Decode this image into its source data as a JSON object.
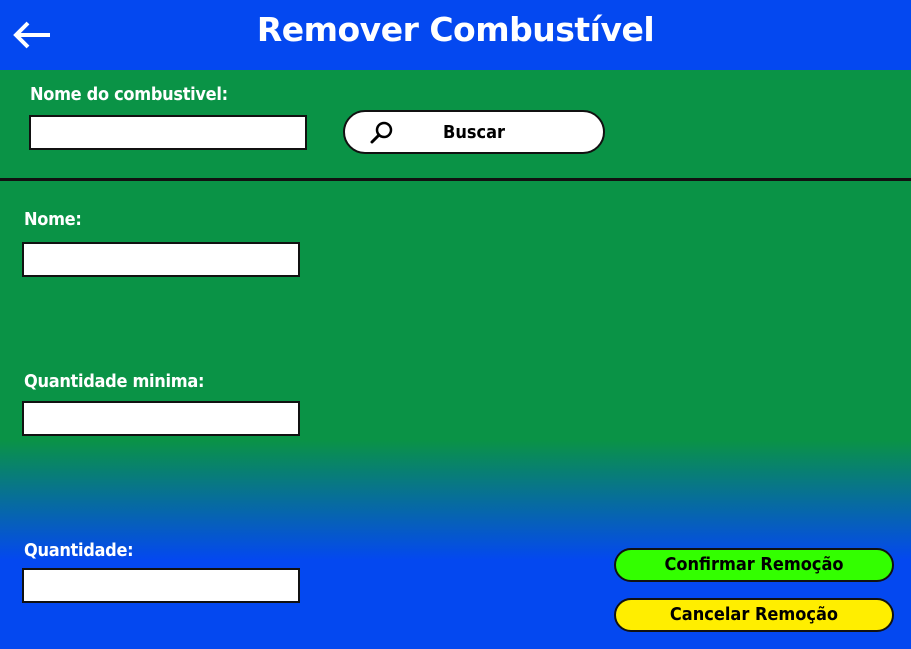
{
  "header": {
    "title": "Remover Combustível",
    "back_icon": "arrow-left-icon",
    "color": "#0448f0"
  },
  "search": {
    "label": "Nome do combustivel:",
    "value": "",
    "button_label": "Buscar",
    "button_icon": "search-icon"
  },
  "form": {
    "nome_label": "Nome:",
    "nome_value": "",
    "quantidade_minima_label": "Quantidade minima:",
    "quantidade_minima_value": "",
    "quantidade_label": "Quantidade:",
    "quantidade_value": ""
  },
  "actions": {
    "confirm_label": "Confirmar Remoção",
    "confirm_color": "#33ff00",
    "cancel_label": "Cancelar Remoção",
    "cancel_color": "#ffee00"
  },
  "colors": {
    "green_background": "#0a9346",
    "blue_background": "#0448f0"
  }
}
